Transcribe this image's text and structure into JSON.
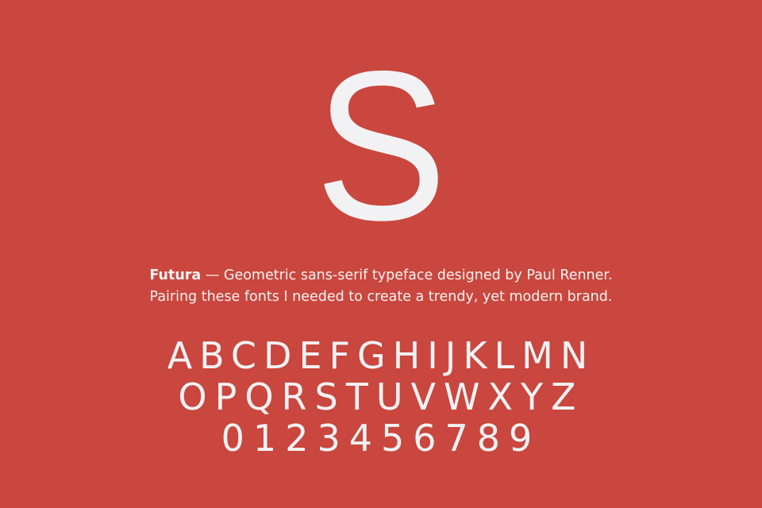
{
  "specimen_glyph": "S",
  "description": {
    "font_name": "Futura",
    "dash": "—",
    "line1_rest": "Geometric sans-serif typeface designed by Paul Renner.",
    "line2": "Pairing these fonts I needed to create a trendy, yet modern brand."
  },
  "alphabet": {
    "row1": "ABCDEFGHIJKLMN",
    "row2": "OPQRSTUVWXYZ",
    "digits": "0123456789"
  },
  "colors": {
    "background": "#c9473e",
    "text": "#f2f2f4"
  }
}
